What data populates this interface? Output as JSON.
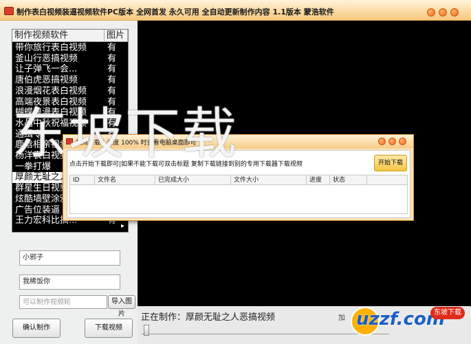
{
  "window": {
    "title": "制作表白视频装逼视频软件PC版本 全网首发  永久可用 全自动更新制作内容 1.1版本 蒙浩软件"
  },
  "video_list": {
    "col_name": "制作视频软件",
    "col_image": "图片",
    "rows": [
      {
        "name": "带你旅行表白视频",
        "has_image": "有"
      },
      {
        "name": "釜山行恶搞视频",
        "has_image": "有"
      },
      {
        "name": "让子弹飞一会...",
        "has_image": "有"
      },
      {
        "name": "唐伯虎恶搞视频",
        "has_image": "有"
      },
      {
        "name": "浪漫烟花表白视频",
        "has_image": "有"
      },
      {
        "name": "高端夜景表白视频",
        "has_image": "有"
      },
      {
        "name": "蝴蝶浪漫表白视频",
        "has_image": "有"
      },
      {
        "name": "水晶中秋祝福视频",
        "has_image": "有"
      },
      {
        "name": "通缉令",
        "has_image": "有"
      },
      {
        "name": "鹿晗相亲视频",
        "has_image": "有"
      },
      {
        "name": "杨洋表白视频",
        "has_image": "有"
      },
      {
        "name": "一拳打爆",
        "has_image": "有"
      },
      {
        "name": "厚颜无耻之人恶搞视频",
        "has_image": "有"
      },
      {
        "name": "群星生日视频",
        "has_image": "有"
      },
      {
        "name": "炫酷墙壁涂鸦",
        "has_image": "有"
      },
      {
        "name": "广告位装逼",
        "has_image": "有"
      },
      {
        "name": "王力宏科比搞...",
        "has_image": "有"
      }
    ],
    "selected_index": 12
  },
  "form": {
    "name1_value": "小邪子",
    "name2_value": "我稀饭你",
    "image_placeholder": "可以制作视频轮",
    "import_image_label": "导入图片",
    "confirm_label": "确认制作",
    "download_label": "下载视频"
  },
  "status": {
    "making_prefix": "正在制作：",
    "making_value": "厚颜无耻之人恶搞视频",
    "extra": "加"
  },
  "dialog": {
    "title": "视频下载 [ 进度 100% 时查看电脑桌面即可",
    "instructions": "点击开始下载即可|如果不能下载可双击标题 复制下载链接到别的专用下载器下载视频",
    "start_label": "开始下载",
    "columns": [
      "ID",
      "文件名",
      "已完成大小",
      "文件大小",
      "进度",
      "状态"
    ]
  },
  "watermarks": {
    "big_text": "东坡下载",
    "site_text": "uzzf.com",
    "badge_text": "东坡下载"
  },
  "colors": {
    "accent_orange": "#ee6a1a",
    "frame": "#fde4b8",
    "video_bg": "#000000"
  }
}
